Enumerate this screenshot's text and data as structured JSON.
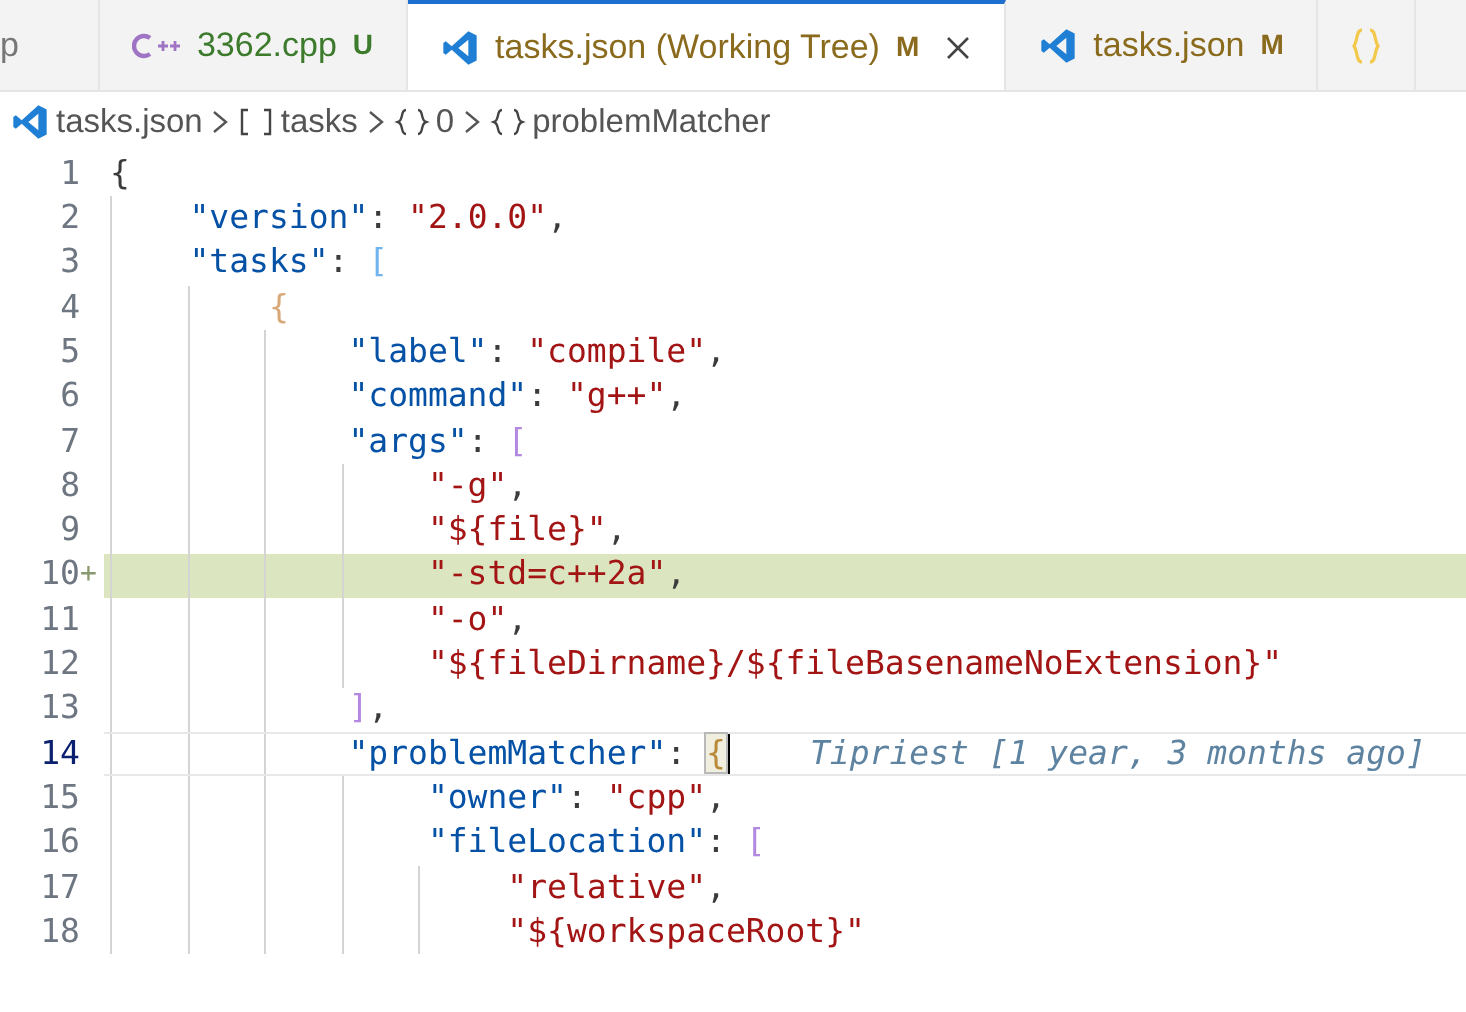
{
  "tabs": [
    {
      "label": "p",
      "kind": "plain",
      "selected": false
    },
    {
      "label": "3362.cpp",
      "kind": "cpp",
      "status": "U",
      "selected": false
    },
    {
      "label": "tasks.json (Working Tree)",
      "kind": "json",
      "status": "M",
      "selected": true
    },
    {
      "label": "tasks.json",
      "kind": "json",
      "status": "M",
      "selected": false
    },
    {
      "kind": "braces",
      "selected": false
    }
  ],
  "breadcrumb": [
    {
      "kind": "file",
      "text": "tasks.json"
    },
    {
      "kind": "array",
      "text": "tasks"
    },
    {
      "kind": "object",
      "text": "0"
    },
    {
      "kind": "object",
      "text": "problemMatcher"
    }
  ],
  "lines": [
    {
      "number": "1",
      "tokens": [
        {
          "kind": "bracket",
          "text": "{",
          "color": "#3b3b3b"
        }
      ],
      "children": [
        {
          "number": "2",
          "tokens": [
            {
              "kind": "key",
              "text": "\"version\""
            },
            {
              "kind": "punct",
              "text": ": "
            },
            {
              "kind": "string",
              "text": "\"2.0.0\""
            },
            {
              "kind": "punct",
              "text": ","
            }
          ]
        },
        {
          "number": "3",
          "tokens": [
            {
              "kind": "key",
              "text": "\"tasks\""
            },
            {
              "kind": "punct",
              "text": ": "
            },
            {
              "kind": "bracket",
              "text": "[",
              "color": "#6fb4ee"
            }
          ],
          "children": [
            {
              "number": "4",
              "tokens": [
                {
                  "kind": "bracket",
                  "text": "{",
                  "color": "#d9a878"
                }
              ],
              "children": [
                {
                  "number": "5",
                  "tokens": [
                    {
                      "kind": "key",
                      "text": "\"label\""
                    },
                    {
                      "kind": "punct",
                      "text": ": "
                    },
                    {
                      "kind": "string",
                      "text": "\"compile\""
                    },
                    {
                      "kind": "punct",
                      "text": ","
                    }
                  ]
                },
                {
                  "number": "6",
                  "tokens": [
                    {
                      "kind": "key",
                      "text": "\"command\""
                    },
                    {
                      "kind": "punct",
                      "text": ": "
                    },
                    {
                      "kind": "string",
                      "text": "\"g++\""
                    },
                    {
                      "kind": "punct",
                      "text": ","
                    }
                  ]
                },
                {
                  "number": "7",
                  "tokens": [
                    {
                      "kind": "key",
                      "text": "\"args\""
                    },
                    {
                      "kind": "punct",
                      "text": ": "
                    },
                    {
                      "kind": "bracket",
                      "text": "[",
                      "color": "#b388e0"
                    }
                  ],
                  "children": [
                    {
                      "number": "8",
                      "tokens": [
                        {
                          "kind": "string",
                          "text": "\"-g\""
                        },
                        {
                          "kind": "punct",
                          "text": ","
                        }
                      ]
                    },
                    {
                      "number": "9",
                      "tokens": [
                        {
                          "kind": "string",
                          "text": "\"${file}\""
                        },
                        {
                          "kind": "punct",
                          "text": ","
                        }
                      ]
                    },
                    {
                      "number": "10",
                      "marker": "+",
                      "added": true,
                      "tokens": [
                        {
                          "kind": "string",
                          "text": "\"-std=c++2a\""
                        },
                        {
                          "kind": "punct",
                          "text": ","
                        }
                      ]
                    },
                    {
                      "number": "11",
                      "tokens": [
                        {
                          "kind": "string",
                          "text": "\"-o\""
                        },
                        {
                          "kind": "punct",
                          "text": ","
                        }
                      ]
                    },
                    {
                      "number": "12",
                      "tokens": [
                        {
                          "kind": "string",
                          "text": "\"${fileDirname}/${fileBasenameNoExtension}\""
                        }
                      ]
                    }
                  ]
                },
                {
                  "number": "13",
                  "tokens": [
                    {
                      "kind": "bracket",
                      "text": "]",
                      "color": "#b388e0"
                    },
                    {
                      "kind": "punct",
                      "text": ","
                    }
                  ]
                },
                {
                  "number": "14",
                  "current": true,
                  "blame": "Tipriest [1 year, 3 months ago]",
                  "tokens": [
                    {
                      "kind": "key",
                      "text": "\"problemMatcher\""
                    },
                    {
                      "kind": "punct",
                      "text": ": "
                    },
                    {
                      "kind": "bracket",
                      "text": "{",
                      "color": "#b88a3a",
                      "matched": true
                    }
                  ],
                  "children": [
                    {
                      "number": "15",
                      "tokens": [
                        {
                          "kind": "key",
                          "text": "\"owner\""
                        },
                        {
                          "kind": "punct",
                          "text": ": "
                        },
                        {
                          "kind": "string",
                          "text": "\"cpp\""
                        },
                        {
                          "kind": "punct",
                          "text": ","
                        }
                      ]
                    },
                    {
                      "number": "16",
                      "tokens": [
                        {
                          "kind": "key",
                          "text": "\"fileLocation\""
                        },
                        {
                          "kind": "punct",
                          "text": ": "
                        },
                        {
                          "kind": "bracket",
                          "text": "[",
                          "color": "#b388e0"
                        }
                      ],
                      "children": [
                        {
                          "number": "17",
                          "tokens": [
                            {
                              "kind": "string",
                              "text": "\"relative\""
                            },
                            {
                              "kind": "punct",
                              "text": ","
                            }
                          ]
                        },
                        {
                          "number": "18",
                          "tokens": [
                            {
                              "kind": "string",
                              "text": "\"${workspaceRoot}\""
                            }
                          ]
                        }
                      ]
                    }
                  ]
                }
              ]
            }
          ]
        }
      ]
    }
  ]
}
